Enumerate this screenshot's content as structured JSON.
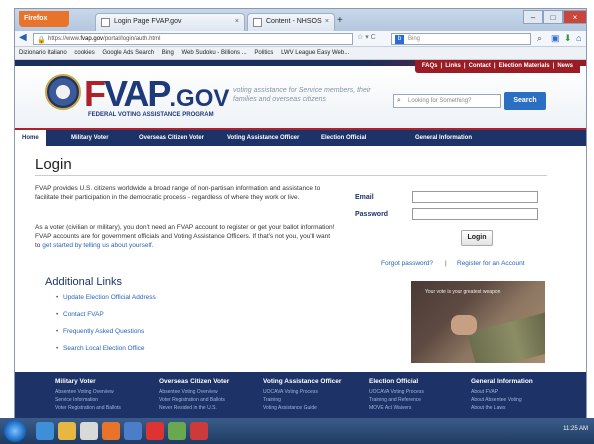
{
  "browser": {
    "firefox_button": "Firefox",
    "tabs": [
      {
        "label": "Login Page FVAP.gov"
      },
      {
        "label": "Content - NHSOS"
      }
    ],
    "new_tab": "+",
    "url_prefix": "https://www.",
    "url_host": "fvap.gov",
    "url_path": "/portal/login/auth.html",
    "url_controls": "☆ ▾ C",
    "search_placeholder": "Bing",
    "bookmarks": [
      "Dizionario Italiano",
      "cookies",
      "Google Ads Search",
      "Bing",
      "Web Sudoku - Billions ...",
      "Politics",
      "LWV League Easy Web..."
    ]
  },
  "site": {
    "top_links": [
      "FAQs",
      "Links",
      "Contact",
      "Election Materials",
      "News"
    ],
    "logo_f": "F",
    "logo_vap": "VAP",
    "logo_gov": ".GOV",
    "logo_sub": "FEDERAL VOTING ASSISTANCE PROGRAM",
    "tagline": "voting assistance for Service members, their families and overseas citizens",
    "search_placeholder": "Looking for Something?",
    "search_button": "Search",
    "nav": [
      "Home",
      "Military Voter",
      "Overseas Citizen Voter",
      "Voting Assistance Officer",
      "Election Official",
      "General Information"
    ]
  },
  "login": {
    "title": "Login",
    "para1": "FVAP provides U.S. citizens worldwide a broad range of non-partisan information and assistance to facilitate their participation in the democratic process - regardless of where they work or live.",
    "para2_text": "As a voter (civilian or military), you don't need an FVAP account to register or get your ballot information! FVAP accounts are for government officials and Voting Assistance Officers. If that's not you, you'll want to ",
    "para2_link": "get started by telling us about yourself.",
    "email_label": "Email",
    "password_label": "Password",
    "login_button": "Login",
    "forgot": "Forgot password?",
    "separator": "|",
    "register": "Register for an Account",
    "photo_caption": "Your vote is your greatest weapon"
  },
  "additional_links": {
    "heading": "Additional Links",
    "items": [
      "Update Election Official Address",
      "Contact FVAP",
      "Frequently Asked Questions",
      "Search Local Election Office"
    ]
  },
  "footer": {
    "columns": [
      {
        "heading": "Military Voter",
        "links": [
          "Absentee Voting Overview",
          "Service Information",
          "Voter Registration and Ballots"
        ]
      },
      {
        "heading": "Overseas Citizen Voter",
        "links": [
          "Absentee Voting Overview",
          "Voter Registration and Ballots",
          "Never Resided in the U.S."
        ]
      },
      {
        "heading": "Voting Assistance Officer",
        "links": [
          "UOCAVA Voting Process",
          "Training",
          "Voting Assistance Guide"
        ]
      },
      {
        "heading": "Election Official",
        "links": [
          "UOCAVA Voting Process",
          "Training and Reference",
          "MOVE Act Waivers"
        ]
      },
      {
        "heading": "General Information",
        "links": [
          "About FVAP",
          "About Absentee Voting",
          "About the Laws"
        ]
      }
    ]
  },
  "taskbar": {
    "clock": "11:25 AM"
  }
}
